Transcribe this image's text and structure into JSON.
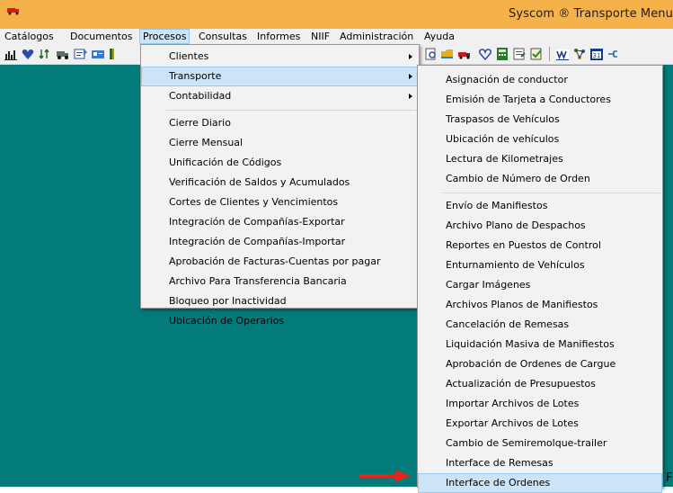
{
  "window": {
    "title": "Syscom ® Transporte Menu"
  },
  "menubar": {
    "items": [
      "Catálogos",
      "Documentos",
      "Procesos",
      "Consultas",
      "Informes",
      "NIIF",
      "Administración",
      "Ayuda"
    ],
    "active": "Procesos"
  },
  "procesos_menu": {
    "group1": [
      "Clientes",
      "Transporte",
      "Contabilidad"
    ],
    "group2": [
      "Cierre Diario",
      "Cierre Mensual",
      "Unificación de Códigos",
      "Verificación de Saldos y Acumulados",
      "Cortes de Clientes y Vencimientos",
      "Integración de Compañías-Exportar",
      "Integración de Compañías-Importar",
      "Aprobación de Facturas-Cuentas por pagar",
      "Archivo Para Transferencia Bancaria",
      "Bloqueo por Inactividad",
      "Ubicación de Operarios"
    ],
    "selected": "Transporte"
  },
  "transporte_menu": {
    "group1": [
      "Asignación de conductor",
      "Emisión de Tarjeta a Conductores",
      "Traspasos de Vehículos",
      "Ubicación de vehículos",
      "Lectura de Kilometrajes",
      "Cambio de Número de Orden"
    ],
    "group2": [
      "Envío de Manifiestos",
      "Archivo Plano de Despachos",
      "Reportes en Puestos de Control",
      "Enturnamiento de Vehículos",
      "Cargar Imágenes",
      "Archivos Planos de Manifiestos",
      "Cancelación de Remesas",
      "Liquidación Masiva de Manifiestos",
      "Aprobación de Ordenes de Cargue",
      "Actualización de Presupuestos",
      "Importar Archivos de Lotes",
      "Exportar Archivos de Lotes",
      "Cambio de Semiremolque-trailer",
      "Interface de Remesas",
      "Interface de Ordenes"
    ],
    "selected": "Interface de Ordenes"
  },
  "annotation": {
    "arrow_color": "#e8231c",
    "trailing_text": "FI"
  },
  "colors": {
    "titlebar": "#f5b14a",
    "workspace": "#037b7b",
    "highlight": "#cce4f7"
  },
  "toolbar": {
    "icons": [
      "chart-icon",
      "heart-icon",
      "arrows-icon",
      "truck-icon",
      "document-icon",
      "card-icon",
      "bar-icon",
      "preview-icon",
      "folder-icon",
      "truck-small-icon",
      "heart-small-icon",
      "calculator-icon",
      "notepad-icon",
      "check-icon",
      "word-icon",
      "graph-icon",
      "calendar-icon",
      "cable-icon"
    ]
  }
}
